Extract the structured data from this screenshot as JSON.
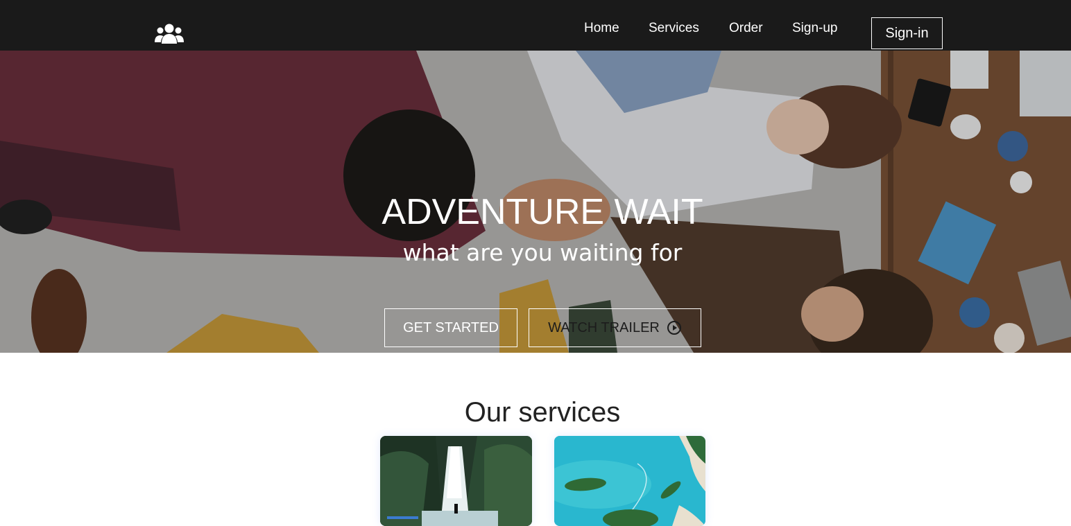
{
  "navbar": {
    "logo_icon": "users-icon",
    "links": [
      "Home",
      "Services",
      "Order",
      "Sign-up"
    ],
    "signin_label": "Sign-in",
    "background": "#1a1a1a"
  },
  "hero": {
    "title": "ADVENTURE WAIT",
    "subtitle": "what are you waiting for",
    "get_started_label": "GET STARTED",
    "watch_trailer_label": "WATCH TRAILER",
    "trailer_icon": "play-circle-icon"
  },
  "services": {
    "title": "Our services",
    "cards": [
      {
        "image": "waterfall-photo"
      },
      {
        "image": "tropical-island-photo"
      }
    ]
  }
}
